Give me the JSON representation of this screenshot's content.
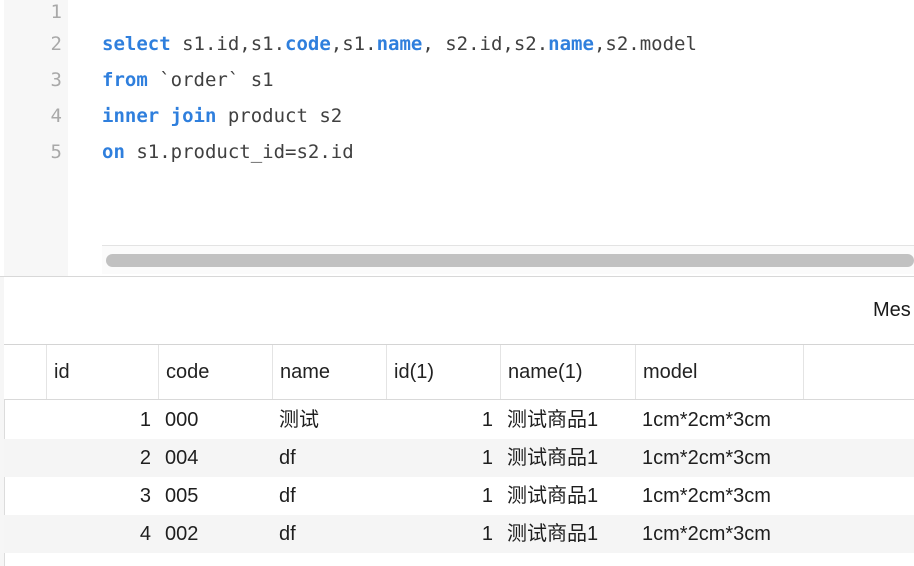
{
  "editor": {
    "line_numbers": [
      "1",
      "2",
      "3",
      "4",
      "5"
    ],
    "lines": [
      [],
      [
        {
          "t": "select",
          "kw": true
        },
        {
          "t": " s1.id,s1.",
          "kw": false
        },
        {
          "t": "code",
          "kw": true
        },
        {
          "t": ",s1.",
          "kw": false
        },
        {
          "t": "name",
          "kw": true
        },
        {
          "t": ", s2.id,s2.",
          "kw": false
        },
        {
          "t": "name",
          "kw": true
        },
        {
          "t": ",s2.model",
          "kw": false
        }
      ],
      [
        {
          "t": "from",
          "kw": true
        },
        {
          "t": " `order` s1",
          "kw": false
        }
      ],
      [
        {
          "t": "inner join",
          "kw": true
        },
        {
          "t": " product s2",
          "kw": false
        }
      ],
      [
        {
          "t": "on",
          "kw": true
        },
        {
          "t": " s1.product_id=s2.id",
          "kw": false
        }
      ]
    ]
  },
  "result_panel": {
    "message_tab_label": "Mes"
  },
  "grid": {
    "columns": [
      "id",
      "code",
      "name",
      "id(1)",
      "name(1)",
      "model"
    ],
    "rows": [
      [
        "1",
        "000",
        "测试",
        "1",
        "测试商品1",
        "1cm*2cm*3cm"
      ],
      [
        "2",
        "004",
        "df",
        "1",
        "测试商品1",
        "1cm*2cm*3cm"
      ],
      [
        "3",
        "005",
        "df",
        "1",
        "测试商品1",
        "1cm*2cm*3cm"
      ],
      [
        "4",
        "002",
        "df",
        "1",
        "测试商品1",
        "1cm*2cm*3cm"
      ]
    ]
  }
}
